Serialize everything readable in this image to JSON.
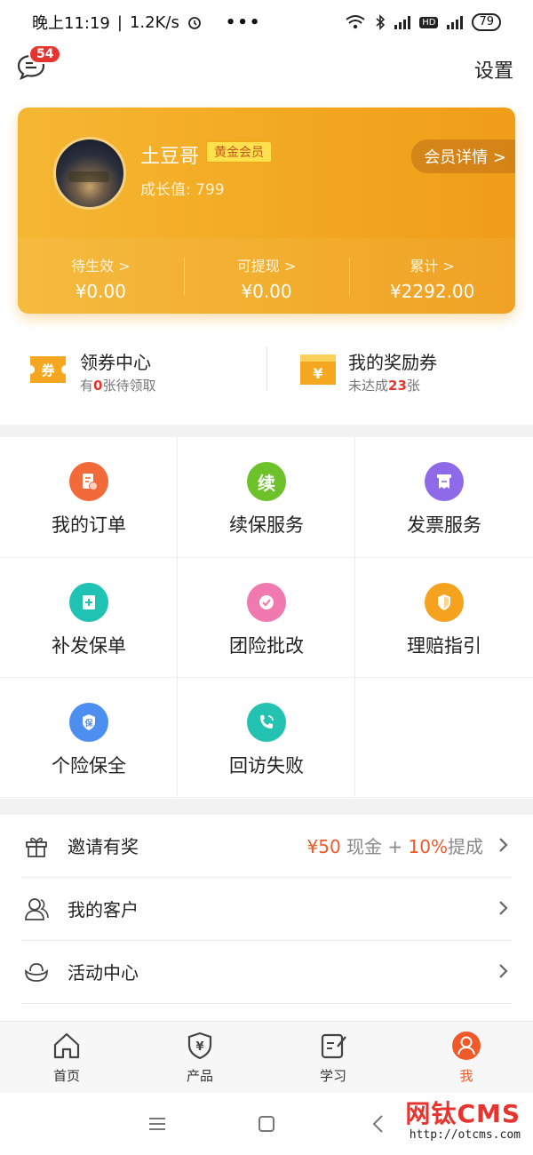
{
  "status_bar": {
    "time": "晚上11:19",
    "speed": "1.2K/s",
    "battery": "79"
  },
  "header": {
    "message_badge": "54",
    "settings_label": "设置"
  },
  "member_card": {
    "username": "土豆哥",
    "level": "黄金会员",
    "growth": "成长值: 799",
    "detail_button": "会员详情 >",
    "stats": [
      {
        "label": "待生效 >",
        "value": "¥0.00"
      },
      {
        "label": "可提现 >",
        "value": "¥0.00"
      },
      {
        "label": "累计 >",
        "value": "¥2292.00"
      }
    ]
  },
  "coupons": {
    "left": {
      "title": "领券中心",
      "sub_prefix": "有",
      "sub_num": "0",
      "sub_suffix": "张待领取"
    },
    "right": {
      "title": "我的奖励券",
      "sub_prefix": "未达成",
      "sub_num": "23",
      "sub_suffix": "张"
    }
  },
  "services": [
    {
      "label": "我的订单",
      "icon": "order-icon",
      "color": "#f26a3a"
    },
    {
      "label": "续保服务",
      "icon": "renew-icon",
      "color": "#6dc22b"
    },
    {
      "label": "发票服务",
      "icon": "invoice-icon",
      "color": "#8e6ae8"
    },
    {
      "label": "补发保单",
      "icon": "reissue-icon",
      "color": "#1fc2b3"
    },
    {
      "label": "团险批改",
      "icon": "check-icon",
      "color": "#f07ab0"
    },
    {
      "label": "理赔指引",
      "icon": "claim-icon",
      "color": "#f5a21f"
    },
    {
      "label": "个险保全",
      "icon": "shield-icon",
      "color": "#4c8ff0"
    },
    {
      "label": "回访失败",
      "icon": "phone-icon",
      "color": "#24c2b0"
    }
  ],
  "list": [
    {
      "label": "邀请有奖",
      "extra_a": "¥50",
      "extra_b": " 现金 + ",
      "extra_c": "10%",
      "extra_d": "提成"
    },
    {
      "label": "我的客户"
    },
    {
      "label": "活动中心"
    }
  ],
  "tabs": [
    {
      "label": "首页"
    },
    {
      "label": "产品"
    },
    {
      "label": "学习"
    },
    {
      "label": "我"
    }
  ],
  "watermark": {
    "title": "网钛CMS",
    "url": "http://otcms.com"
  }
}
